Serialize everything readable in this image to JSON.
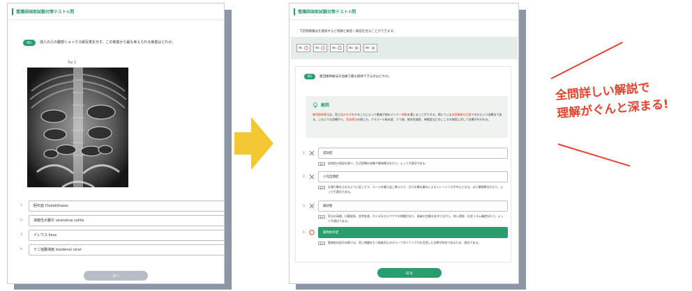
{
  "left_card": {
    "header_title": "看護師国家試験対策テスト①問",
    "question_badge": "問1",
    "question_text": "成人の小の腹部ショックス線写真を示す。この疾患から最も考えられる疾患はどれか。",
    "image_label": "%s 1",
    "choices": [
      {
        "num": "1.",
        "label": "胆石症 Cholelithiasis"
      },
      {
        "num": "2.",
        "label": "潰瘍性大腸炎 ulcerative colitis"
      },
      {
        "num": "3.",
        "label": "イレウス ileus"
      },
      {
        "num": "4.",
        "label": "十二指腸潰瘍 duodenal ulcer"
      }
    ],
    "next_button": "次へ"
  },
  "right_card": {
    "header_title": "看護師国家試験対策テスト①問",
    "instruction": "下記問題番号を選択すると問題と解答・解説を見ることができます。",
    "results": [
      {
        "num": "問1",
        "mark": "correct"
      },
      {
        "num": "問2",
        "mark": "correct"
      },
      {
        "num": "問3",
        "mark": "correct"
      },
      {
        "num": "問4",
        "mark": "wrong"
      },
      {
        "num": "問5",
        "mark": "wrong"
      }
    ],
    "question_badge": "問1",
    "question_text": "集団精神療法の治療で最も期待できるのはどれか。",
    "explanation_title": "解説",
    "explanation_parts": [
      {
        "text": "集団精神療法",
        "red": true
      },
      {
        "text": "は、同じ",
        "red": false
      },
      {
        "text": "悩みを共有",
        "red": true
      },
      {
        "text": "することによって患者が他のメンバー",
        "red": false
      },
      {
        "text": "体験",
        "red": true
      },
      {
        "text": "を通じることができる。問いている",
        "red": false
      },
      {
        "text": "自我機能を回復",
        "red": true
      },
      {
        "text": "できるという治療法である。このような治療から、",
        "red": false
      },
      {
        "text": "家族療法",
        "red": true
      },
      {
        "text": "の他にも、アルコール依存症、うつ病、統合失調症、神経症などのこころの病気に対して治療が行われる。",
        "red": false
      }
    ],
    "choices": [
      {
        "num": "1.",
        "mark": "wrong",
        "label": "認知症",
        "tag": "解説",
        "expl": "認知症の原因を調べ、生活習慣の改善や薬物療法を行う。よって不適切である。"
      },
      {
        "num": "2.",
        "mark": "wrong",
        "label": "小児自閉症",
        "tag": "解説",
        "expl": "反復行動を止めるように促したり、ルールを繰り返し教えたり、日々の積み重ねによるトレーニングが中心となる。また薬物療法も行う。よって不適切である。"
      },
      {
        "num": "3.",
        "mark": "wrong",
        "label": "躁状態",
        "tag": "解説",
        "expl": "気分の高揚、行動過多、思考奔逸、不十分なセルフケアの問題があり、患者の言動を見守りながら、刺入環境・社会リズム構造を行う。よって不適切である。"
      },
      {
        "num": "4.",
        "mark": "correct",
        "label": "薬物依存症",
        "tag": "解説",
        "expl": "薬物依存症の治療では、同じ問題をもつ患者同士のグループダイナミクスを活用した治療が有効であるため、適切である。"
      }
    ],
    "back_button": "戻る"
  },
  "callout": {
    "line1": "全問詳しい解説で",
    "line2": "理解がぐんと深まる!"
  },
  "colors": {
    "accent_green": "#2a9d6f",
    "wrong_purple": "#7a6fb0",
    "correct_red": "#e4432d",
    "arrow_yellow": "#f3c633",
    "callout_red": "#e4432d"
  }
}
